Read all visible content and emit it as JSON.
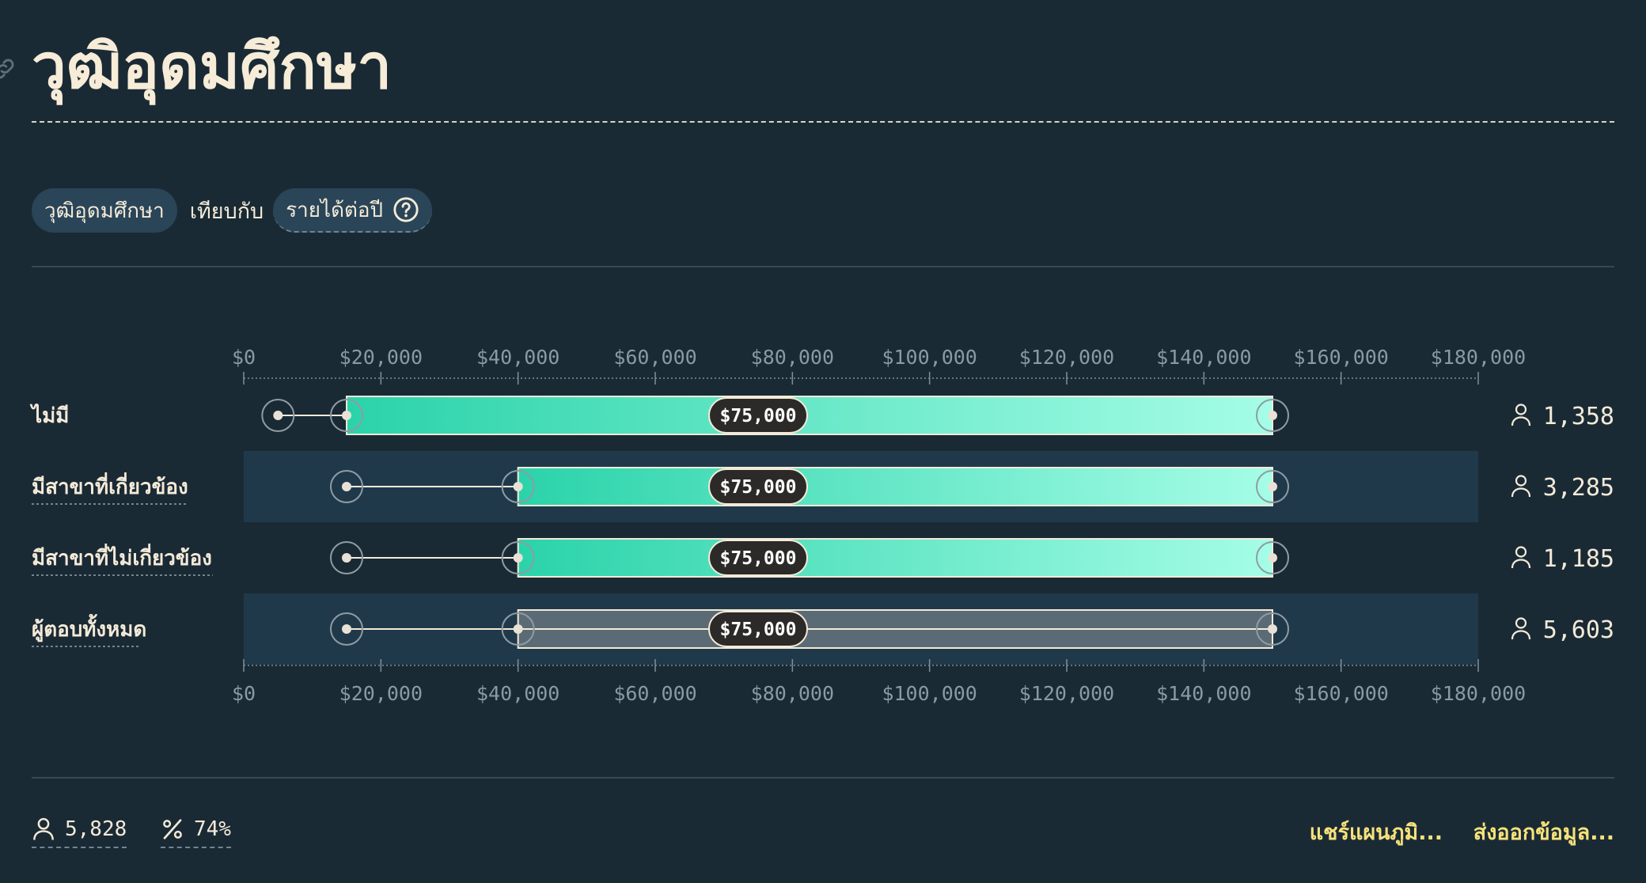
{
  "page": {
    "title": "วุฒิอุดมศึกษา",
    "colors": {
      "background": "#1a2a35",
      "bar_gradient_start": "#2bd3aa",
      "bar_gradient_end": "#a5fde6",
      "total_bar": "#5b6b75",
      "link": "#f7e27a"
    }
  },
  "controls": {
    "dimension_chip": "วุฒิอุดมศึกษา",
    "versus_text": "เทียบกับ",
    "metric_chip": "รายได้ต่อปี",
    "help_icon": "help-circle-icon"
  },
  "chart_data": {
    "type": "range-bar",
    "x_axis": {
      "min": 0,
      "max": 180000,
      "step": 20000,
      "tick_labels": [
        "$0",
        "$20,000",
        "$40,000",
        "$60,000",
        "$80,000",
        "$100,000",
        "$120,000",
        "$140,000",
        "$160,000",
        "$180,000"
      ]
    },
    "grid": false,
    "rows": [
      {
        "label": "ไม่มี",
        "min": 5000,
        "p25": 15000,
        "median": 75000,
        "median_label": "$75,000",
        "p75": 150000,
        "max": 150000,
        "count": "1,358",
        "style": "gradient"
      },
      {
        "label": "มีสาขาที่เกี่ยวข้อง",
        "min": 15000,
        "p25": 40000,
        "median": 75000,
        "median_label": "$75,000",
        "p75": 150000,
        "max": 150000,
        "count": "3,285",
        "style": "gradient"
      },
      {
        "label": "มีสาขาที่ไม่เกี่ยวข้อง",
        "min": 15000,
        "p25": 40000,
        "median": 75000,
        "median_label": "$75,000",
        "p75": 150000,
        "max": 150000,
        "count": "1,185",
        "style": "gradient"
      },
      {
        "label": "ผู้ตอบทั้งหมด",
        "min": 15000,
        "p25": 40000,
        "median": 75000,
        "median_label": "$75,000",
        "p75": 150000,
        "max": 150000,
        "count": "5,603",
        "style": "total"
      }
    ]
  },
  "footer": {
    "respondents": "5,828",
    "percent": "74%",
    "share_link": "แชร์แผนภูมิ...",
    "export_link": "ส่งออกข้อมูล..."
  }
}
